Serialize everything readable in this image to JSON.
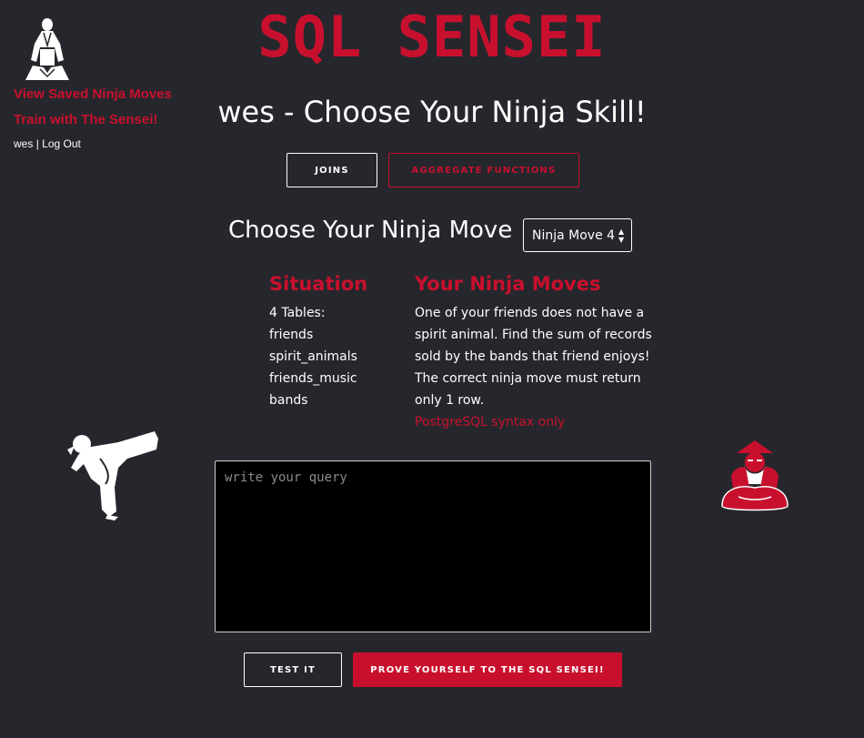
{
  "header": {
    "title": "SQL SENSEI",
    "heading": "wes - Choose Your Ninja Skill!"
  },
  "nav": {
    "saved_moves": "View Saved Ninja Moves",
    "train": "Train with The Sensei!",
    "username": "wes",
    "separator": "|",
    "logout": "Log Out"
  },
  "skills": {
    "joins_label": "JOINS",
    "aggregate_label": "AGGREGATE FUNCTIONS"
  },
  "move_picker": {
    "label": "Choose Your Ninja Move",
    "selected": "Ninja Move 4"
  },
  "situation": {
    "heading": "Situation",
    "lines": [
      "4 Tables:",
      "friends",
      "spirit_animals",
      "friends_music",
      "bands"
    ]
  },
  "ninja_moves": {
    "heading": "Your Ninja Moves",
    "description": "One of your friends does not have a spirit animal. Find the sum of records sold by the bands that friend enjoys! The correct ninja move must return only 1 row.",
    "note": "PostgreSQL syntax only"
  },
  "query": {
    "placeholder": "write your query",
    "value": ""
  },
  "actions": {
    "test_label": "TEST IT",
    "prove_label": "PROVE YOURSELF TO THE SQL SENSEI!"
  },
  "icons": {
    "logo": "ninja-meditating-icon",
    "kick": "ninja-kick-icon",
    "sensei": "sensei-icon"
  },
  "colors": {
    "background": "#26272c",
    "accent": "#c8102e",
    "text": "#ffffff"
  }
}
